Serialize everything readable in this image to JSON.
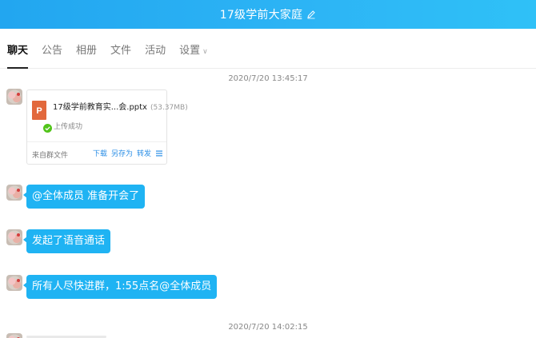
{
  "window": {
    "title": "17级学前大家庭"
  },
  "tabs": [
    {
      "label": "聊天",
      "active": true
    },
    {
      "label": "公告"
    },
    {
      "label": "相册"
    },
    {
      "label": "文件"
    },
    {
      "label": "活动"
    },
    {
      "label": "设置",
      "has_dropdown": true
    }
  ],
  "messages": {
    "timestamp_1": "2020/7/20 13:45:17",
    "file": {
      "name": "17级学前教育实...会.pptx",
      "size": "(53.37MB)",
      "status": "上传成功",
      "source": "来自群文件",
      "actions": [
        "下载",
        "另存为",
        "转发"
      ],
      "icon": "ppt-file-icon",
      "status_icon": "check-circle-icon"
    },
    "bubble_1": "@全体成员 准备开会了",
    "bubble_2": "发起了语音通话",
    "bubble_3": "所有人尽快进群，1:55点名@全体成员",
    "timestamp_2": "2020/7/20 14:02:15"
  },
  "colors": {
    "title_bar": "#22a6f0",
    "bubble": "#1fb3f3",
    "link": "#2a8ee6",
    "ppt_icon": "#e2683c",
    "success": "#52c41a"
  }
}
